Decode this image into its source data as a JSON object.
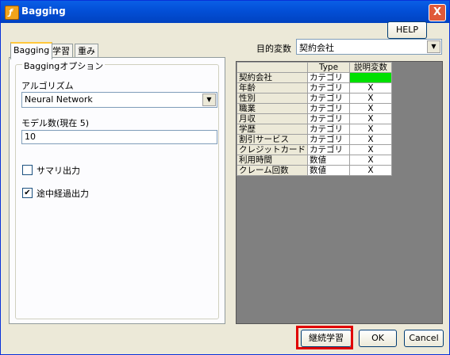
{
  "window": {
    "title": "Bagging",
    "close_label": "X"
  },
  "help_label": "HELP",
  "target": {
    "label": "目的変数",
    "value": "契約会社"
  },
  "tabs": [
    "Bagging",
    "学習",
    "重み"
  ],
  "options": {
    "legend": "Baggingオプション",
    "algorithm_label": "アルゴリズム",
    "algorithm_value": "Neural Network",
    "model_count_label": "モデル数(現在 5)",
    "model_count_value": "10",
    "summary_label": "サマリ出力",
    "summary_checked": false,
    "progress_label": "途中経過出力",
    "progress_checked": true
  },
  "table": {
    "headers": [
      "",
      "Type",
      "説明変数"
    ],
    "rows": [
      {
        "name": "契約会社",
        "type": "カテゴリ",
        "flag": ""
      },
      {
        "name": "年齢",
        "type": "カテゴリ",
        "flag": "X"
      },
      {
        "name": "性別",
        "type": "カテゴリ",
        "flag": "X"
      },
      {
        "name": "職業",
        "type": "カテゴリ",
        "flag": "X"
      },
      {
        "name": "月収",
        "type": "カテゴリ",
        "flag": "X"
      },
      {
        "name": "学歴",
        "type": "カテゴリ",
        "flag": "X"
      },
      {
        "name": "割引サービス",
        "type": "カテゴリ",
        "flag": "X"
      },
      {
        "name": "クレジットカード",
        "type": "カテゴリ",
        "flag": "X"
      },
      {
        "name": "利用時間",
        "type": "数値",
        "flag": "X"
      },
      {
        "name": "クレーム回数",
        "type": "数値",
        "flag": "X"
      }
    ],
    "target_cell_color": "#00e000"
  },
  "buttons": {
    "continue": "継続学習",
    "ok": "OK",
    "cancel": "Cancel"
  }
}
